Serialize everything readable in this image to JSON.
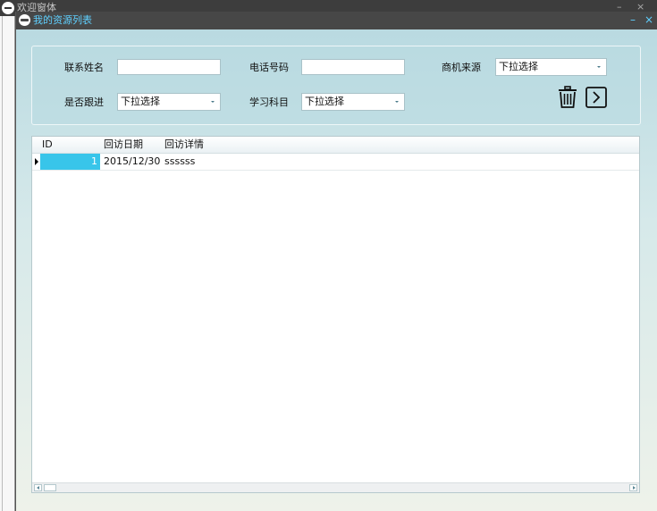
{
  "parent_window": {
    "title": "欢迎窗体",
    "minimize": "–",
    "close": "×"
  },
  "window": {
    "title": "我的资源列表",
    "minimize": "–",
    "close": "×"
  },
  "search": {
    "contact_name": {
      "label": "联系姓名",
      "value": ""
    },
    "phone": {
      "label": "电话号码",
      "value": ""
    },
    "source": {
      "label": "商机来源",
      "value": "下拉选择"
    },
    "follow_up": {
      "label": "是否跟进",
      "value": "下拉选择"
    },
    "subject": {
      "label": "学习科目",
      "value": "下拉选择"
    }
  },
  "icons": {
    "delete": "trash-icon",
    "next": "chevron-right-icon"
  },
  "grid": {
    "columns": [
      "ID",
      "回访日期",
      "回访详情"
    ],
    "rows": [
      {
        "id": "1",
        "date": "2015/12/30",
        "detail": "ssssss"
      }
    ]
  },
  "colors": {
    "title_text": "#5fd0ff",
    "selection": "#38c5ea",
    "titlebar": "#474747"
  }
}
